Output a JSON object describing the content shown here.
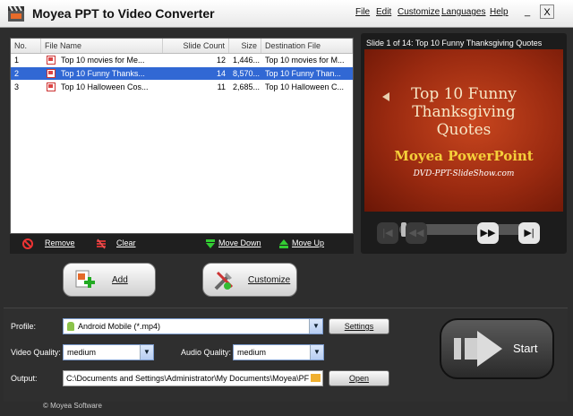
{
  "app": {
    "title": "Moyea PPT to Video Converter"
  },
  "menu": [
    "File",
    "Edit",
    "Customize",
    "Languages",
    "Help"
  ],
  "window_controls": {
    "minimize": "_",
    "close": "X"
  },
  "file_list": {
    "columns": [
      "No.",
      "File Name",
      "Slide Count",
      "Size",
      "Destination File"
    ],
    "rows": [
      {
        "no": "1",
        "name": "Top 10 movies for Me...",
        "slides": "12",
        "size": "1,446...",
        "dest": "Top 10 movies for M..."
      },
      {
        "no": "2",
        "name": "Top 10 Funny Thanks...",
        "slides": "14",
        "size": "8,570...",
        "dest": "Top 10 Funny Than..."
      },
      {
        "no": "3",
        "name": "Top 10 Halloween Cos...",
        "slides": "11",
        "size": "2,685...",
        "dest": "Top 10 Halloween C..."
      }
    ],
    "selected_row": 2
  },
  "list_toolbar": {
    "remove": "Remove",
    "clear": "Clear",
    "move_down": "Move Down",
    "move_up": "Move Up"
  },
  "preview": {
    "title": "Slide 1 of 14: Top 10 Funny Thanksgiving Quotes",
    "slide_lines": [
      "Top 10 Funny",
      "Thanksgiving",
      "Quotes",
      "Moyea PowerPoint",
      "DVD-PPT-SlideShow.com"
    ]
  },
  "actions": {
    "add": "Add",
    "customize": "Customize"
  },
  "options": {
    "profile_label": "Profile:",
    "profile_value": "Android Mobile (*.mp4)",
    "settings": "Settings",
    "video_quality_label": "Video Quality:",
    "video_quality": "medium",
    "audio_quality_label": "Audio Quality:",
    "audio_quality": "medium",
    "output_label": "Output:",
    "output_path": "C:\\Documents and Settings\\Administrator\\My Documents\\Moyea\\PF",
    "open": "Open"
  },
  "start": "Start",
  "status": "© Moyea Software",
  "colors": {
    "selection": "#3168d4",
    "background": "#2d2d2d",
    "accent_gold": "#f5cf3a"
  }
}
